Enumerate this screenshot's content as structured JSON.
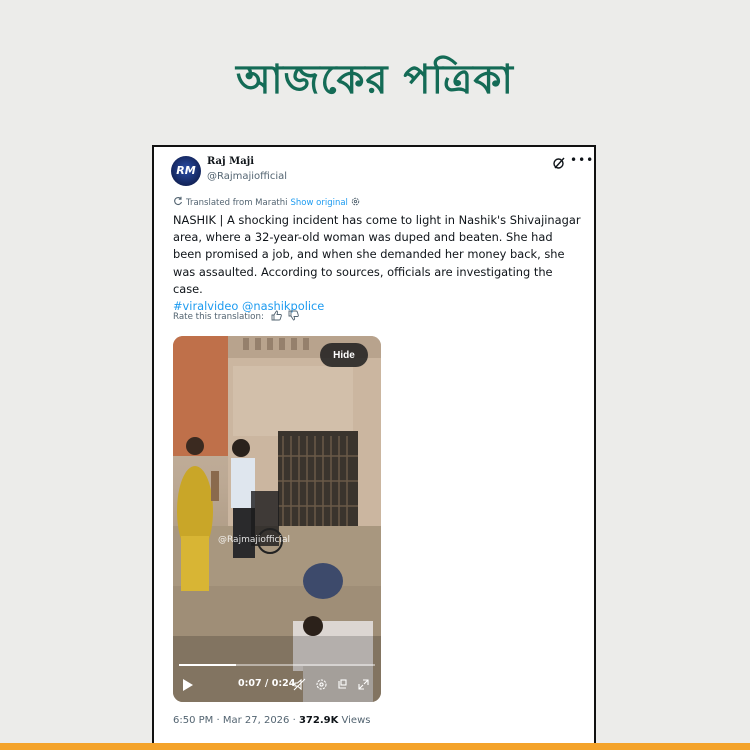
{
  "masthead": {
    "title": "আজকের পত্রিকা"
  },
  "tweet": {
    "author": {
      "display_name": "Raj Maji",
      "handle": "@Rajmajiofficial",
      "avatar_text": "RM"
    },
    "translation": {
      "label": "Translated from Marathi",
      "show_original": "Show original"
    },
    "text": "NASHIK | A shocking incident has come to light in Nashik's Shivajinagar area, where a 32-year-old woman was duped and beaten. She had been promised a job, and when she demanded her money back, she was assaulted. According to sources, officials are investigating the case.",
    "hashtags": "#viralvideo @nashikpolice",
    "rate_translation": "Rate this translation:",
    "video": {
      "hide_label": "Hide",
      "watermark": "@Rajmajiofficial",
      "time": "0:07 / 0:24",
      "progress": 0.29
    },
    "timestamp": "6:50 PM · Mar 27, 2026 · ",
    "views_count": "372.9K",
    "views_label": " Views"
  },
  "colors": {
    "brand": "#146b56",
    "link": "#1d9bf0",
    "accent_strip": "#f4a32a"
  },
  "icons": [
    "grok-icon",
    "more-icon",
    "translate-icon",
    "settings-icon",
    "thumbs-up-icon",
    "thumbs-down-icon",
    "play-icon",
    "mute-icon",
    "settings-icon",
    "pip-icon",
    "fullscreen-icon"
  ]
}
